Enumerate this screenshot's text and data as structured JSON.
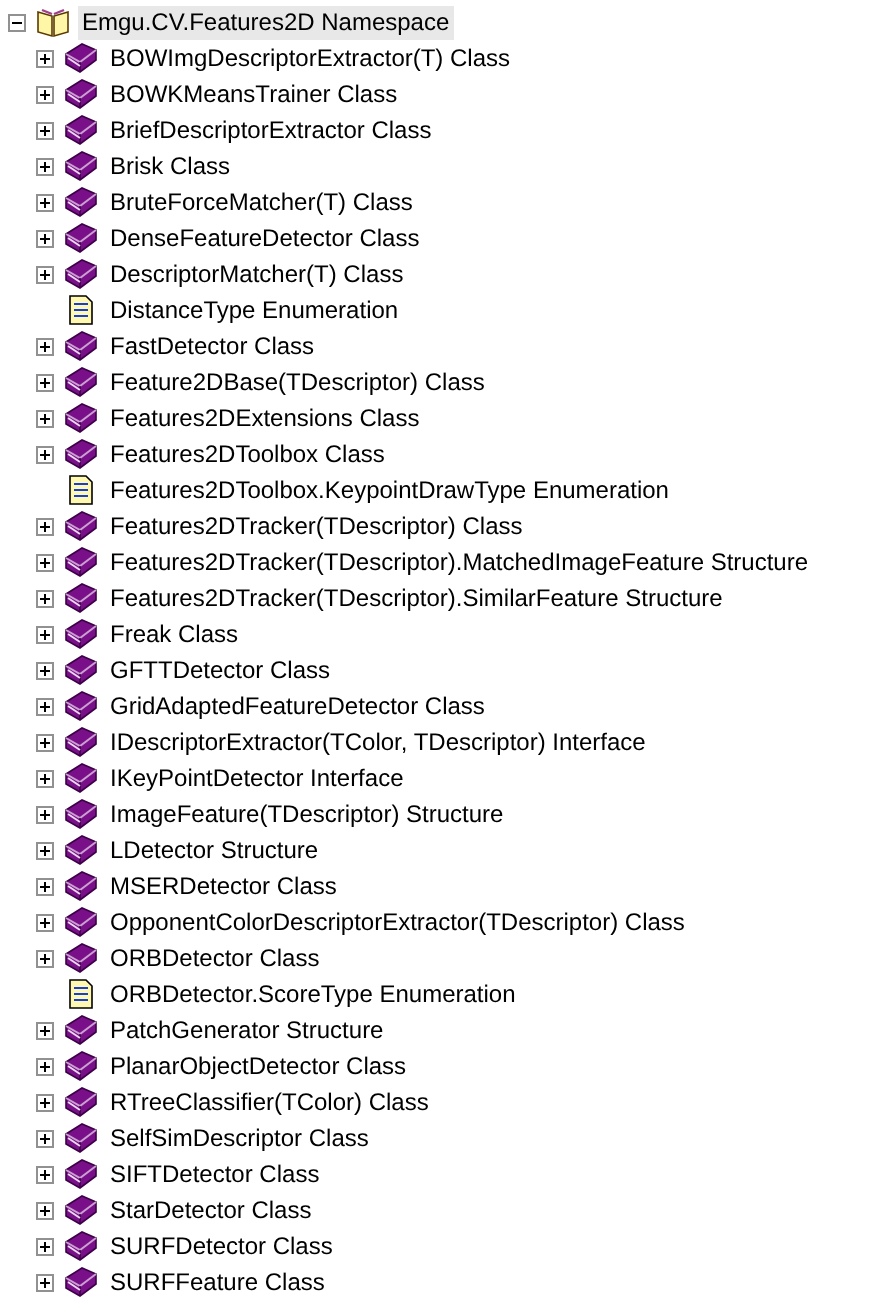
{
  "tree": {
    "label": "Emgu.CV.Features2D Namespace",
    "selected": true,
    "expanded": true,
    "children": [
      {
        "label": "BOWImgDescriptorExtractor(T) Class",
        "kind": "book",
        "expanded": false
      },
      {
        "label": "BOWKMeansTrainer Class",
        "kind": "book",
        "expanded": false
      },
      {
        "label": "BriefDescriptorExtractor Class",
        "kind": "book",
        "expanded": false
      },
      {
        "label": "Brisk Class",
        "kind": "book",
        "expanded": false
      },
      {
        "label": "BruteForceMatcher(T) Class",
        "kind": "book",
        "expanded": false
      },
      {
        "label": "DenseFeatureDetector Class",
        "kind": "book",
        "expanded": false
      },
      {
        "label": "DescriptorMatcher(T) Class",
        "kind": "book",
        "expanded": false
      },
      {
        "label": "DistanceType Enumeration",
        "kind": "page"
      },
      {
        "label": "FastDetector Class",
        "kind": "book",
        "expanded": false
      },
      {
        "label": "Feature2DBase(TDescriptor) Class",
        "kind": "book",
        "expanded": false
      },
      {
        "label": "Features2DExtensions Class",
        "kind": "book",
        "expanded": false
      },
      {
        "label": "Features2DToolbox Class",
        "kind": "book",
        "expanded": false
      },
      {
        "label": "Features2DToolbox.KeypointDrawType Enumeration",
        "kind": "page"
      },
      {
        "label": "Features2DTracker(TDescriptor) Class",
        "kind": "book",
        "expanded": false
      },
      {
        "label": "Features2DTracker(TDescriptor).MatchedImageFeature Structure",
        "kind": "book",
        "expanded": false
      },
      {
        "label": "Features2DTracker(TDescriptor).SimilarFeature Structure",
        "kind": "book",
        "expanded": false
      },
      {
        "label": "Freak Class",
        "kind": "book",
        "expanded": false
      },
      {
        "label": "GFTTDetector Class",
        "kind": "book",
        "expanded": false
      },
      {
        "label": "GridAdaptedFeatureDetector Class",
        "kind": "book",
        "expanded": false
      },
      {
        "label": "IDescriptorExtractor(TColor, TDescriptor) Interface",
        "kind": "book",
        "expanded": false
      },
      {
        "label": "IKeyPointDetector Interface",
        "kind": "book",
        "expanded": false
      },
      {
        "label": "ImageFeature(TDescriptor) Structure",
        "kind": "book",
        "expanded": false
      },
      {
        "label": "LDetector Structure",
        "kind": "book",
        "expanded": false
      },
      {
        "label": "MSERDetector Class",
        "kind": "book",
        "expanded": false
      },
      {
        "label": "OpponentColorDescriptorExtractor(TDescriptor) Class",
        "kind": "book",
        "expanded": false
      },
      {
        "label": "ORBDetector Class",
        "kind": "book",
        "expanded": false
      },
      {
        "label": "ORBDetector.ScoreType Enumeration",
        "kind": "page"
      },
      {
        "label": "PatchGenerator Structure",
        "kind": "book",
        "expanded": false
      },
      {
        "label": "PlanarObjectDetector Class",
        "kind": "book",
        "expanded": false
      },
      {
        "label": "RTreeClassifier(TColor) Class",
        "kind": "book",
        "expanded": false
      },
      {
        "label": "SelfSimDescriptor Class",
        "kind": "book",
        "expanded": false
      },
      {
        "label": "SIFTDetector Class",
        "kind": "book",
        "expanded": false
      },
      {
        "label": "StarDetector Class",
        "kind": "book",
        "expanded": false
      },
      {
        "label": "SURFDetector Class",
        "kind": "book",
        "expanded": false
      },
      {
        "label": "SURFFeature Class",
        "kind": "book",
        "expanded": false
      }
    ]
  }
}
